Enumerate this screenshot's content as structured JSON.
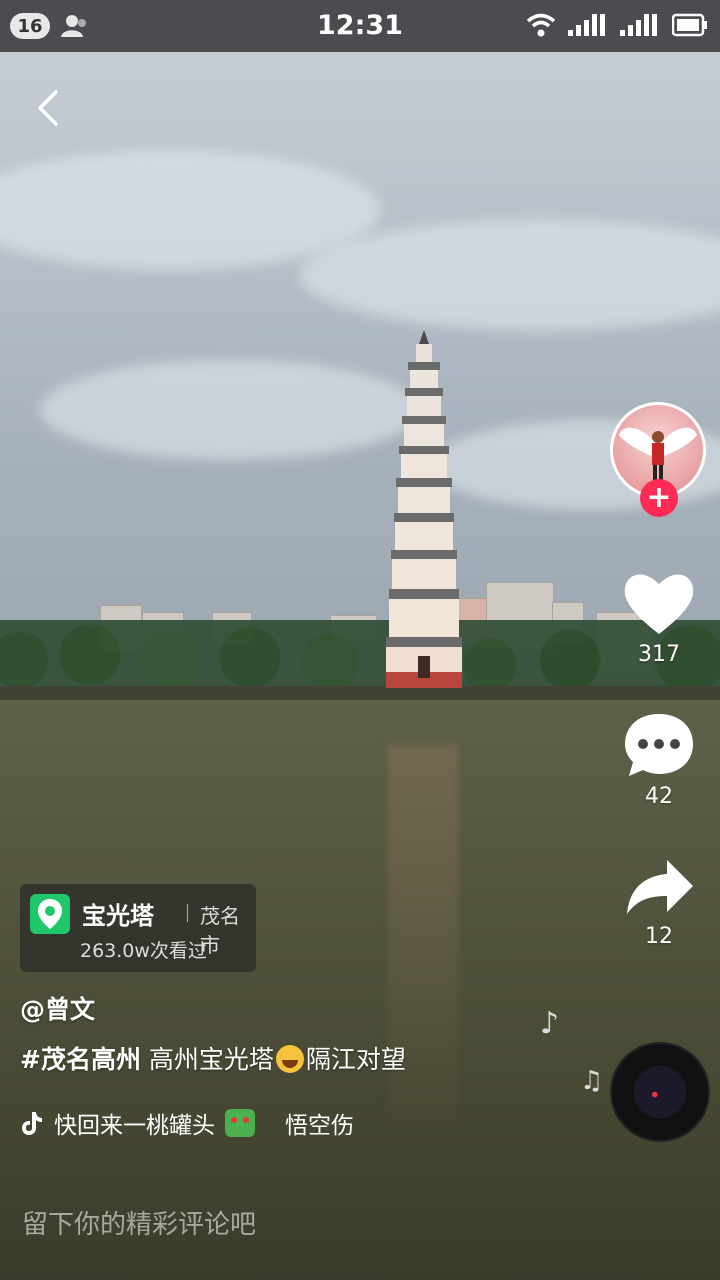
{
  "status_bar": {
    "notification_count": "16",
    "time": "12:31",
    "icons": [
      "person-icon",
      "wifi-icon",
      "signal-icon",
      "signal-icon",
      "battery-icon"
    ]
  },
  "nav": {
    "back_icon": "chevron-left-icon"
  },
  "actions": {
    "likes": "317",
    "comments": "42",
    "shares": "12",
    "follow_icon": "plus-icon",
    "accent": "#fe2c55"
  },
  "location": {
    "name": "宝光塔",
    "city": "茂名市",
    "views": "263.0w次看过",
    "pin_color": "#1fc76a"
  },
  "post": {
    "author": "@曾文",
    "hashtag": "#茂名高州",
    "caption_part1": "高州宝光塔",
    "caption_part2": "隔江对望"
  },
  "music": {
    "text": "快回来一桃罐头",
    "artist": "悟空伤"
  },
  "comment_placeholder": "留下你的精彩评论吧"
}
